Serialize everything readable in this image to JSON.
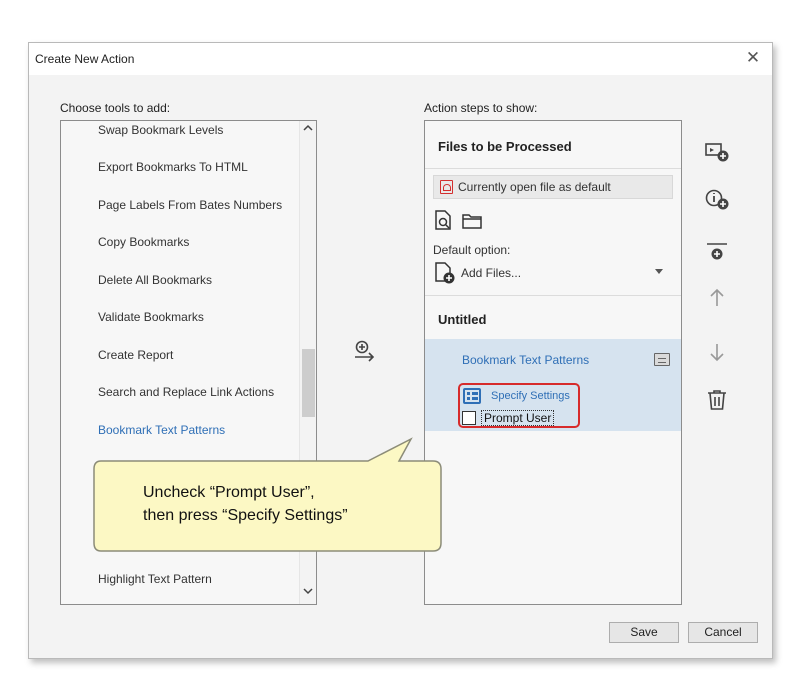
{
  "window": {
    "title": "Create New Action",
    "close_glyph": "✕"
  },
  "tools_panel": {
    "label": "Choose tools to add:",
    "items": [
      "Swap Bookmark Levels",
      "Export Bookmarks To HTML",
      "Page Labels From Bates Numbers",
      "Copy Bookmarks",
      "Delete All Bookmarks",
      "Validate Bookmarks",
      "Create Report",
      "Search and Replace Link Actions",
      "Bookmark Text Patterns"
    ],
    "last_item": "Highlight Text Pattern",
    "selected_item": "Bookmark Text Patterns"
  },
  "steps_panel": {
    "label": "Action steps to show:",
    "files_header": "Files to be Processed",
    "file_default": "Currently open file as default",
    "default_option_label": "Default option:",
    "add_files_value": "Add Files...",
    "group_header": "Untitled",
    "step_name": "Bookmark Text Patterns",
    "specify_settings_label": "Specify Settings",
    "prompt_user_label": "Prompt User",
    "prompt_user_checked": false
  },
  "toolbar_icons": [
    "add-file-icon",
    "add-instruction-icon",
    "add-panel-icon",
    "move-up-icon",
    "move-down-icon",
    "delete-icon"
  ],
  "callout": {
    "line1": "Uncheck “Prompt User”,",
    "line2": "then press “Specify Settings”"
  },
  "buttons": {
    "save": "Save",
    "cancel": "Cancel"
  },
  "colors": {
    "accent": "#2f6fb6",
    "highlight_border": "#d72b2b",
    "selected_row": "#d6e3ef",
    "callout_fill": "#fcf8c4"
  }
}
